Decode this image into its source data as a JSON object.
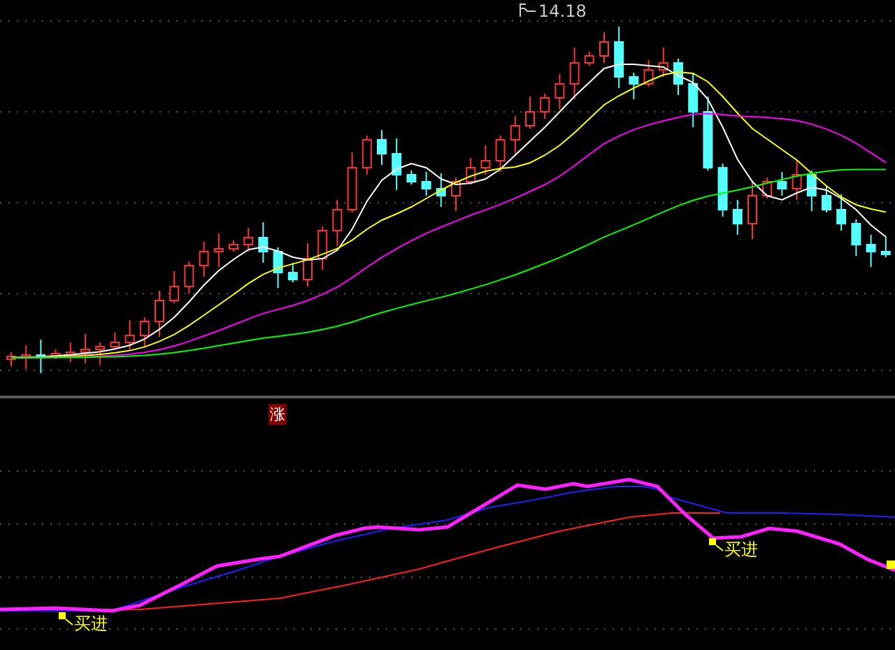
{
  "price_pane": {
    "high_label": "14.18"
  },
  "indicator_pane": {
    "marker": "涨",
    "signals": [
      {
        "label": "买进"
      },
      {
        "label": "买进"
      }
    ]
  }
}
